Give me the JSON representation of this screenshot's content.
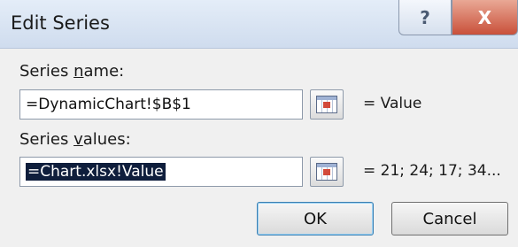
{
  "window": {
    "title": "Edit Series",
    "help_glyph": "?",
    "close_glyph": "X"
  },
  "series_name": {
    "label_pre": "Series ",
    "label_underlined": "n",
    "label_post": "ame:",
    "value": "=DynamicChart!$B$1",
    "preview": "= Value"
  },
  "series_values": {
    "label_pre": "Series ",
    "label_underlined": "v",
    "label_post": "alues:",
    "value": "=Chart.xlsx!Value",
    "preview": "= 21; 24; 17; 34..."
  },
  "buttons": {
    "ok": "OK",
    "cancel": "Cancel"
  }
}
